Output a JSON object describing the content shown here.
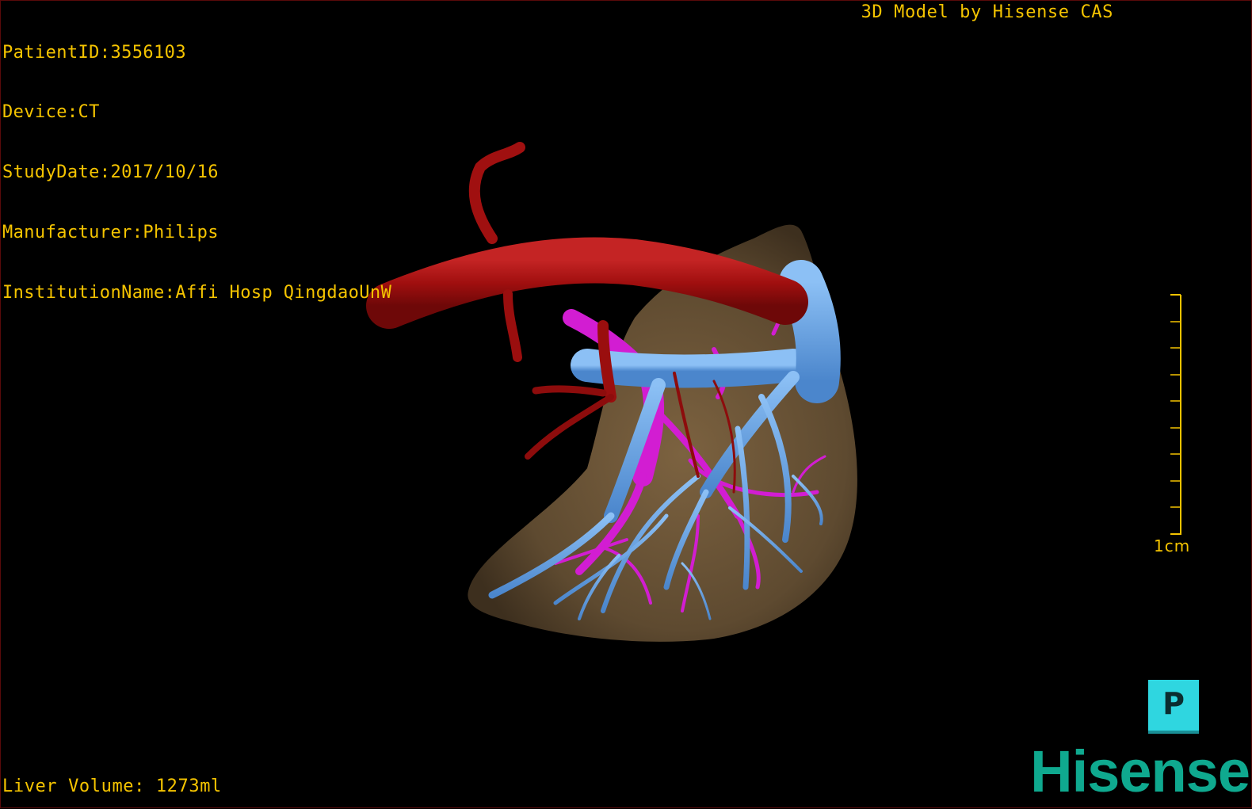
{
  "overlay": {
    "patient_id": "PatientID:3556103",
    "device": "Device:CT",
    "study_date": "StudyDate:2017/10/16",
    "manufacturer": "Manufacturer:Philips",
    "institution": "InstitutionName:Affi Hosp QingdaoUnW"
  },
  "credit": "3D Model by Hisense CAS",
  "volume": "Liver Volume: 1273ml",
  "scale": {
    "label": "1cm"
  },
  "orientation": {
    "glyph": "P"
  },
  "brand": {
    "name": "Hisense"
  },
  "colors": {
    "text": "#f5c400",
    "liver": "#6b5437",
    "artery": "#a01010",
    "portal_vein": "#5b9ee8",
    "hepatic_vein": "#d21dd2",
    "cube": "#2fd6e0",
    "brand": "#0fa98f"
  },
  "icons": {
    "orientation_cube": "orientation-cube-icon"
  }
}
